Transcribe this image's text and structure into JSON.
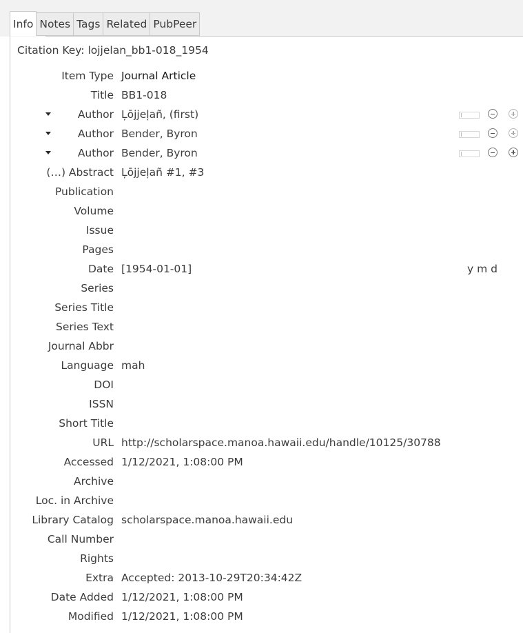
{
  "tabs": [
    "Info",
    "Notes",
    "Tags",
    "Related",
    "PubPeer"
  ],
  "citation_key": "Citation Key: lojjelan_bb1-018_1954",
  "fields": [
    {
      "label": "Item Type",
      "value": "Journal Article"
    },
    {
      "label": "Title",
      "value": "BB1-018"
    },
    {
      "label": "Author",
      "value": "Ļōjjeļañ, (first)"
    },
    {
      "label": "Author",
      "value": "Bender, Byron"
    },
    {
      "label": "Author",
      "value": "Bender, Byron"
    },
    {
      "label": "(…) Abstract",
      "value": "Ļōjjeļañ #1, #3"
    },
    {
      "label": "Publication",
      "value": ""
    },
    {
      "label": "Volume",
      "value": ""
    },
    {
      "label": "Issue",
      "value": ""
    },
    {
      "label": "Pages",
      "value": ""
    },
    {
      "label": "Date",
      "value": "[1954-01-01]",
      "suffix": "y m d"
    },
    {
      "label": "Series",
      "value": ""
    },
    {
      "label": "Series Title",
      "value": ""
    },
    {
      "label": "Series Text",
      "value": ""
    },
    {
      "label": "Journal Abbr",
      "value": ""
    },
    {
      "label": "Language",
      "value": "mah"
    },
    {
      "label": "DOI",
      "value": ""
    },
    {
      "label": "ISSN",
      "value": ""
    },
    {
      "label": "Short Title",
      "value": ""
    },
    {
      "label": "URL",
      "value": "http://scholarspace.manoa.hawaii.edu/handle/10125/30788"
    },
    {
      "label": "Accessed",
      "value": "1/12/2021, 1:08:00 PM"
    },
    {
      "label": "Archive",
      "value": ""
    },
    {
      "label": "Loc. in Archive",
      "value": ""
    },
    {
      "label": "Library Catalog",
      "value": "scholarspace.manoa.hawaii.edu"
    },
    {
      "label": "Call Number",
      "value": ""
    },
    {
      "label": "Rights",
      "value": ""
    },
    {
      "label": "Extra",
      "value": "Accepted: 2013-10-29T20:34:42Z"
    },
    {
      "label": "Date Added",
      "value": "1/12/2021, 1:08:00 PM"
    },
    {
      "label": "Modified",
      "value": "1/12/2021, 1:08:00 PM"
    }
  ],
  "icons": {
    "creator_menu": "caret-down-icon",
    "field_mode": "toggle-box-icon",
    "remove": "minus-circle-icon",
    "add": "plus-circle-icon"
  },
  "colors": {
    "tab_strip": "#f2f2f2",
    "border": "#c8c8c8",
    "text": "#3c3c3c"
  }
}
